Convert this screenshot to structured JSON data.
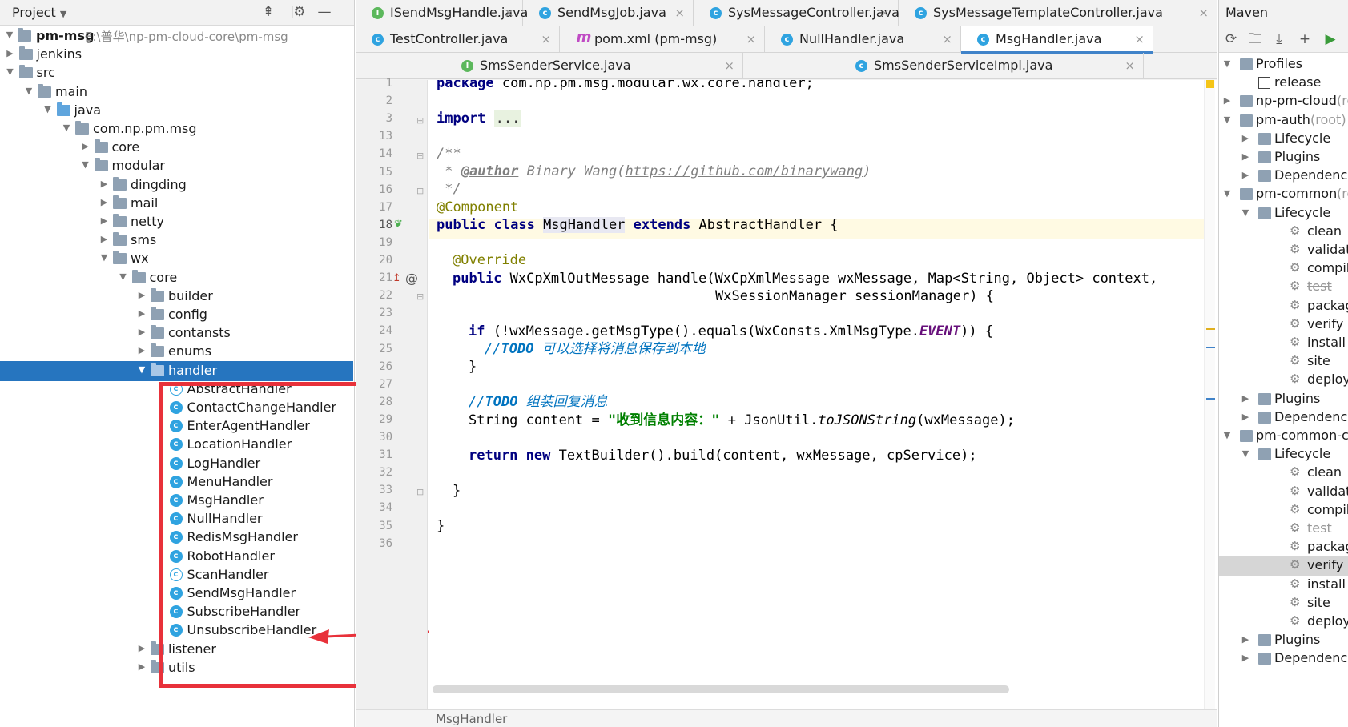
{
  "project": {
    "title": "Project",
    "root": {
      "name": "pm-msg",
      "path": "E:\\普华\\np-pm-cloud-core\\pm-msg"
    },
    "tree": [
      {
        "label": "jenkins",
        "depth": 1,
        "arrow": "right",
        "icon": "folder"
      },
      {
        "label": "src",
        "depth": 1,
        "arrow": "down",
        "icon": "folder"
      },
      {
        "label": "main",
        "depth": 2,
        "arrow": "down",
        "icon": "folder"
      },
      {
        "label": "java",
        "depth": 3,
        "arrow": "down",
        "icon": "folder-blue"
      },
      {
        "label": "com.np.pm.msg",
        "depth": 4,
        "arrow": "down",
        "icon": "folder"
      },
      {
        "label": "core",
        "depth": 5,
        "arrow": "right",
        "icon": "folder"
      },
      {
        "label": "modular",
        "depth": 5,
        "arrow": "down",
        "icon": "folder"
      },
      {
        "label": "dingding",
        "depth": 6,
        "arrow": "right",
        "icon": "folder"
      },
      {
        "label": "mail",
        "depth": 6,
        "arrow": "right",
        "icon": "folder"
      },
      {
        "label": "netty",
        "depth": 6,
        "arrow": "right",
        "icon": "folder"
      },
      {
        "label": "sms",
        "depth": 6,
        "arrow": "right",
        "icon": "folder"
      },
      {
        "label": "wx",
        "depth": 6,
        "arrow": "down",
        "icon": "folder"
      },
      {
        "label": "core",
        "depth": 7,
        "arrow": "down",
        "icon": "folder"
      },
      {
        "label": "builder",
        "depth": 8,
        "arrow": "right",
        "icon": "folder"
      },
      {
        "label": "config",
        "depth": 8,
        "arrow": "right",
        "icon": "folder"
      },
      {
        "label": "contansts",
        "depth": 8,
        "arrow": "right",
        "icon": "folder"
      },
      {
        "label": "enums",
        "depth": 8,
        "arrow": "right",
        "icon": "folder"
      },
      {
        "label": "handler",
        "depth": 8,
        "arrow": "down",
        "icon": "folder",
        "selected": true
      },
      {
        "label": "AbstractHandler",
        "depth": 9,
        "icon": "class-abstract"
      },
      {
        "label": "ContactChangeHandler",
        "depth": 9,
        "icon": "class"
      },
      {
        "label": "EnterAgentHandler",
        "depth": 9,
        "icon": "class"
      },
      {
        "label": "LocationHandler",
        "depth": 9,
        "icon": "class"
      },
      {
        "label": "LogHandler",
        "depth": 9,
        "icon": "class"
      },
      {
        "label": "MenuHandler",
        "depth": 9,
        "icon": "class"
      },
      {
        "label": "MsgHandler",
        "depth": 9,
        "icon": "class"
      },
      {
        "label": "NullHandler",
        "depth": 9,
        "icon": "class"
      },
      {
        "label": "RedisMsgHandler",
        "depth": 9,
        "icon": "class"
      },
      {
        "label": "RobotHandler",
        "depth": 9,
        "icon": "class"
      },
      {
        "label": "ScanHandler",
        "depth": 9,
        "icon": "class-abstract"
      },
      {
        "label": "SendMsgHandler",
        "depth": 9,
        "icon": "class"
      },
      {
        "label": "SubscribeHandler",
        "depth": 9,
        "icon": "class"
      },
      {
        "label": "UnsubscribeHandler",
        "depth": 9,
        "icon": "class"
      },
      {
        "label": "listener",
        "depth": 8,
        "arrow": "right",
        "icon": "folder"
      },
      {
        "label": "utils",
        "depth": 8,
        "arrow": "right",
        "icon": "folder"
      }
    ]
  },
  "tabs": {
    "row1": [
      {
        "label": "ISendMsgHandle.java",
        "icon": "I"
      },
      {
        "label": "SendMsgJob.java",
        "icon": "C"
      },
      {
        "label": "SysMessageController.java",
        "icon": "C"
      },
      {
        "label": "SysMessageTemplateController.java",
        "icon": "C"
      }
    ],
    "row2": [
      {
        "label": "TestController.java",
        "icon": "C"
      },
      {
        "label": "pom.xml (pm-msg)",
        "icon": "m"
      },
      {
        "label": "NullHandler.java",
        "icon": "C"
      },
      {
        "label": "MsgHandler.java",
        "icon": "C",
        "active": true
      }
    ],
    "row3": [
      {
        "label": "SmsSenderService.java",
        "icon": "I"
      },
      {
        "label": "SmsSenderServiceImpl.java",
        "icon": "C"
      }
    ]
  },
  "editor": {
    "line_numbers": [
      "1",
      "2",
      "3",
      "13",
      "14",
      "15",
      "16",
      "17",
      "18",
      "19",
      "20",
      "21",
      "22",
      "23",
      "24",
      "25",
      "26",
      "27",
      "28",
      "29",
      "30",
      "31",
      "32",
      "33",
      "34",
      "35",
      "36"
    ],
    "code": {
      "l1_kw": "package",
      "l1_rest": " com.np.pm.msg.modular.wx.core.handler;",
      "l3_kw": "import",
      "l3_fold": "...",
      "l14": "/**",
      "l15_a": " * ",
      "l15_tag": "@author",
      "l15_name": " Binary Wang(",
      "l15_link": "https://github.com/binarywang",
      "l15_end": ")",
      "l16": " */",
      "l17": "@Component",
      "l18_kw1": "public class ",
      "l18_name": "MsgHandler",
      "l18_kw2": " extends",
      "l18_rest": " AbstractHandler {",
      "l20": "@Override",
      "l21_kw": "public",
      "l21_rest": " WxCpXmlOutMessage handle(WxCpXmlMessage wxMessage, Map<String, Object> context,",
      "l22": "WxSessionManager sessionManager) {",
      "l24_kw": "if",
      "l24_a": " (!wxMessage.getMsgType().equals(WxConsts.XmlMsgType.",
      "l24_field": "EVENT",
      "l24_b": ")) {",
      "l25_slash": "//",
      "l25_todo": "TODO",
      "l25_text": " 可以选择将消息保存到本地",
      "l26": "}",
      "l28_slash": "//",
      "l28_todo": "TODO",
      "l28_text": " 组装回复消息",
      "l29_a": "String content = ",
      "l29_str": "\"收到信息内容：\"",
      "l29_b": " + JsonUtil.",
      "l29_it": "toJSONString",
      "l29_c": "(wxMessage);",
      "l31_kw1": "return",
      "l31_kw2": " new",
      "l31_rest": " TextBuilder().build(content, wxMessage, cpService);",
      "l33": "}",
      "l35": "}"
    },
    "breadcrumb": "MsgHandler"
  },
  "maven": {
    "title": "Maven",
    "tree": [
      {
        "label": "Profiles",
        "depth": 0,
        "arrow": "down",
        "icon": "folder"
      },
      {
        "label": "release",
        "depth": 1,
        "icon": "checkbox"
      },
      {
        "label": "np-pm-cloud",
        "suffix": " (root)",
        "depth": 0,
        "arrow": "right",
        "icon": "module"
      },
      {
        "label": "pm-auth",
        "suffix": " (root)",
        "depth": 0,
        "arrow": "down",
        "icon": "module"
      },
      {
        "label": "Lifecycle",
        "depth": 1,
        "arrow": "right",
        "icon": "folder"
      },
      {
        "label": "Plugins",
        "depth": 1,
        "arrow": "right",
        "icon": "folder"
      },
      {
        "label": "Dependencies",
        "depth": 1,
        "arrow": "right",
        "icon": "folder"
      },
      {
        "label": "pm-common",
        "suffix": " (root)",
        "depth": 0,
        "arrow": "down",
        "icon": "module"
      },
      {
        "label": "Lifecycle",
        "depth": 1,
        "arrow": "down",
        "icon": "folder"
      },
      {
        "label": "clean",
        "depth": 2,
        "icon": "gear"
      },
      {
        "label": "validate",
        "depth": 2,
        "icon": "gear"
      },
      {
        "label": "compile",
        "depth": 2,
        "icon": "gear"
      },
      {
        "label": "test",
        "depth": 2,
        "icon": "gear",
        "strike": true
      },
      {
        "label": "package",
        "depth": 2,
        "icon": "gear"
      },
      {
        "label": "verify",
        "depth": 2,
        "icon": "gear"
      },
      {
        "label": "install",
        "depth": 2,
        "icon": "gear"
      },
      {
        "label": "site",
        "depth": 2,
        "icon": "gear"
      },
      {
        "label": "deploy",
        "depth": 2,
        "icon": "gear"
      },
      {
        "label": "Plugins",
        "depth": 1,
        "arrow": "right",
        "icon": "folder"
      },
      {
        "label": "Dependencies",
        "depth": 1,
        "arrow": "right",
        "icon": "folder"
      },
      {
        "label": "pm-common-core",
        "depth": 0,
        "arrow": "down",
        "icon": "module"
      },
      {
        "label": "Lifecycle",
        "depth": 1,
        "arrow": "down",
        "icon": "folder"
      },
      {
        "label": "clean",
        "depth": 2,
        "icon": "gear"
      },
      {
        "label": "validate",
        "depth": 2,
        "icon": "gear"
      },
      {
        "label": "compile",
        "depth": 2,
        "icon": "gear"
      },
      {
        "label": "test",
        "depth": 2,
        "icon": "gear",
        "strike": true
      },
      {
        "label": "package",
        "depth": 2,
        "icon": "gear"
      },
      {
        "label": "verify",
        "depth": 2,
        "icon": "gear",
        "selected": true
      },
      {
        "label": "install",
        "depth": 2,
        "icon": "gear"
      },
      {
        "label": "site",
        "depth": 2,
        "icon": "gear"
      },
      {
        "label": "deploy",
        "depth": 2,
        "icon": "gear"
      },
      {
        "label": "Plugins",
        "depth": 1,
        "arrow": "right",
        "icon": "folder"
      },
      {
        "label": "Dependencies",
        "depth": 1,
        "arrow": "right",
        "icon": "folder"
      }
    ]
  },
  "colors": {
    "selection": "#2675bf",
    "annotation": "#e8313a",
    "keyword": "#000080",
    "string": "#008000",
    "comment": "#808080"
  }
}
